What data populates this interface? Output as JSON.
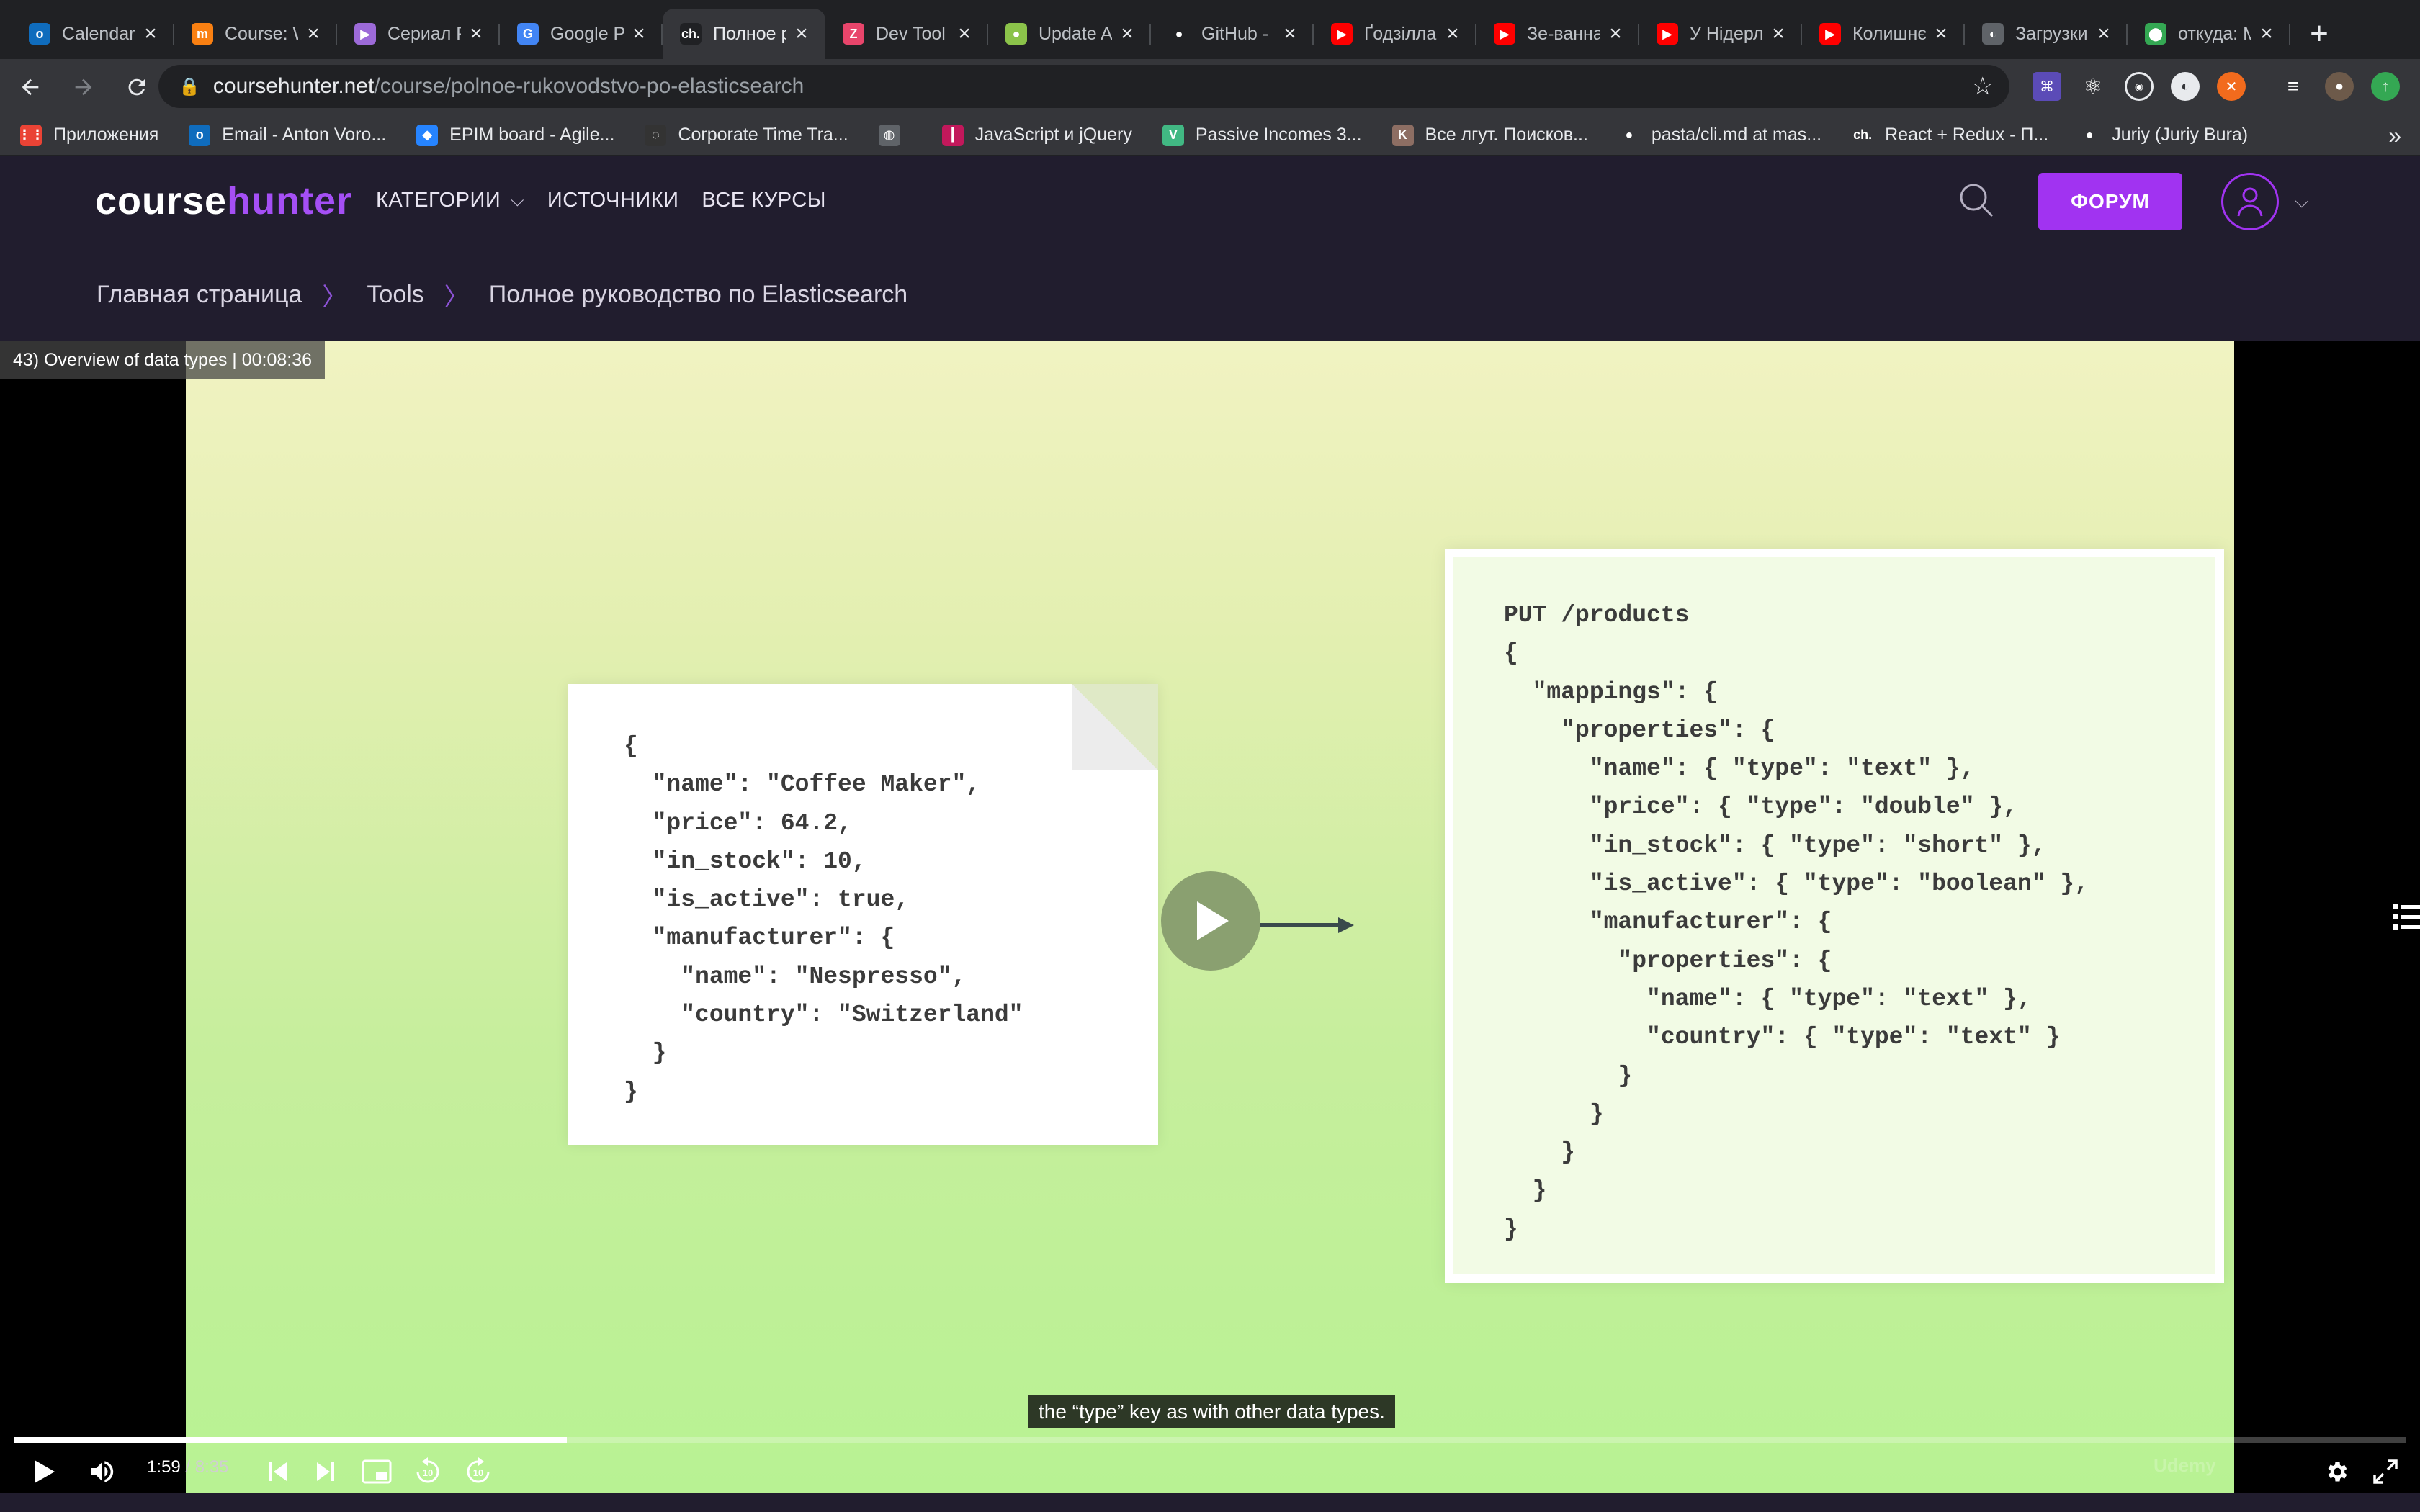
{
  "browser": {
    "tabs": [
      {
        "title": "Calendar",
        "icon": "outlook-icon",
        "color": "#0f6cbd",
        "glyph": "o"
      },
      {
        "title": "Course: W",
        "icon": "moodle-icon",
        "color": "#f98012",
        "glyph": "m"
      },
      {
        "title": "Сериал Р",
        "icon": "tv-icon",
        "color": "#9c6ad8",
        "glyph": "▶"
      },
      {
        "title": "Google Р",
        "icon": "google-translate-icon",
        "color": "#4285f4",
        "glyph": "G"
      },
      {
        "title": "Полное р",
        "icon": "coursehunter-icon",
        "color": "#202124",
        "glyph": "ch."
      },
      {
        "title": "Dev Tool",
        "icon": "devtools-icon",
        "color": "#e8456b",
        "glyph": "Z"
      },
      {
        "title": "Update A",
        "icon": "update-icon",
        "color": "#8bc34a",
        "glyph": "●"
      },
      {
        "title": "GitHub -",
        "icon": "github-icon",
        "color": "#ffffff",
        "glyph": "●"
      },
      {
        "title": "Ґодзілла",
        "icon": "youtube-icon",
        "color": "#ff0000",
        "glyph": "▶"
      },
      {
        "title": "Зе-ванна",
        "icon": "youtube-icon",
        "color": "#ff0000",
        "glyph": "▶"
      },
      {
        "title": "У Нідерл",
        "icon": "youtube-icon",
        "color": "#ff0000",
        "glyph": "▶"
      },
      {
        "title": "Колишнє",
        "icon": "youtube-icon",
        "color": "#ff0000",
        "glyph": "▶"
      },
      {
        "title": "Загрузки",
        "icon": "globe-icon",
        "color": "#5f6368",
        "glyph": "◐"
      },
      {
        "title": "откуда: М",
        "icon": "maps-icon",
        "color": "#34a853",
        "glyph": "⬤"
      }
    ],
    "active_tab": 4,
    "url_host": "coursehunter.net",
    "url_path": "/course/polnoe-rukovodstvo-po-elasticsearch",
    "bookmarks": [
      {
        "label": "Приложения",
        "icon": "apps-grid-icon",
        "color": "#ea4335",
        "glyph": "⋮⋮"
      },
      {
        "label": "Email - Anton Voro...",
        "icon": "outlook-icon",
        "color": "#0f6cbd",
        "glyph": "o"
      },
      {
        "label": "EPIM board - Agile...",
        "icon": "jira-icon",
        "color": "#2684ff",
        "glyph": "◆"
      },
      {
        "label": "Corporate Time Tra...",
        "icon": "clock-icon",
        "color": "#333333",
        "glyph": "◌"
      },
      {
        "label": "",
        "icon": "globe-icon",
        "color": "#5f6368",
        "glyph": "◍"
      },
      {
        "label": "JavaScript и jQuery",
        "icon": "bars-icon",
        "color": "#c2185b",
        "glyph": "┃"
      },
      {
        "label": "Passive Incomes 3...",
        "icon": "vue-icon",
        "color": "#41b883",
        "glyph": "V"
      },
      {
        "label": "Все лгут. Поисков...",
        "icon": "book-icon",
        "color": "#8d6e63",
        "glyph": "K"
      },
      {
        "label": "pasta/cli.md at mas...",
        "icon": "github-icon",
        "color": "#ffffff",
        "glyph": "●"
      },
      {
        "label": "React + Redux - П...",
        "icon": "coursehunter-icon",
        "color": "#35363a",
        "glyph": "ch."
      },
      {
        "label": "Juriy (Juriy Bura)",
        "icon": "github-icon",
        "color": "#ffffff",
        "glyph": "●"
      }
    ]
  },
  "site": {
    "logo_course": "course",
    "logo_hunter": "hunter",
    "menu": [
      "КАТЕГОРИИ",
      "ИСТОЧНИКИ",
      "ВСЕ КУРСЫ"
    ],
    "forum_button": "ФОРУМ",
    "accent": "#a133f1",
    "header_bg": "#211d2e"
  },
  "breadcrumb": [
    "Главная страница",
    "Tools",
    "Полное руководство по Elasticsearch"
  ],
  "player": {
    "title": "43) Overview of data types | 00:08:36",
    "code_left": "{\n  \"name\": \"Coffee Maker\",\n  \"price\": 64.2,\n  \"in_stock\": 10,\n  \"is_active\": true,\n  \"manufacturer\": {\n    \"name\": \"Nespresso\",\n    \"country\": \"Switzerland\"\n  }\n}",
    "code_right": "PUT /products\n{\n  \"mappings\": {\n    \"properties\": {\n      \"name\": { \"type\": \"text\" },\n      \"price\": { \"type\": \"double\" },\n      \"in_stock\": { \"type\": \"short\" },\n      \"is_active\": { \"type\": \"boolean\" },\n      \"manufacturer\": {\n        \"properties\": {\n          \"name\": { \"type\": \"text\" },\n          \"country\": { \"type\": \"text\" }\n        }\n      }\n    }\n  }\n}",
    "caption": "the “type” key as with other data types.",
    "current_time": "1:59",
    "duration": "8:35",
    "progress_fraction": 0.231,
    "watermark": "Udemy"
  }
}
